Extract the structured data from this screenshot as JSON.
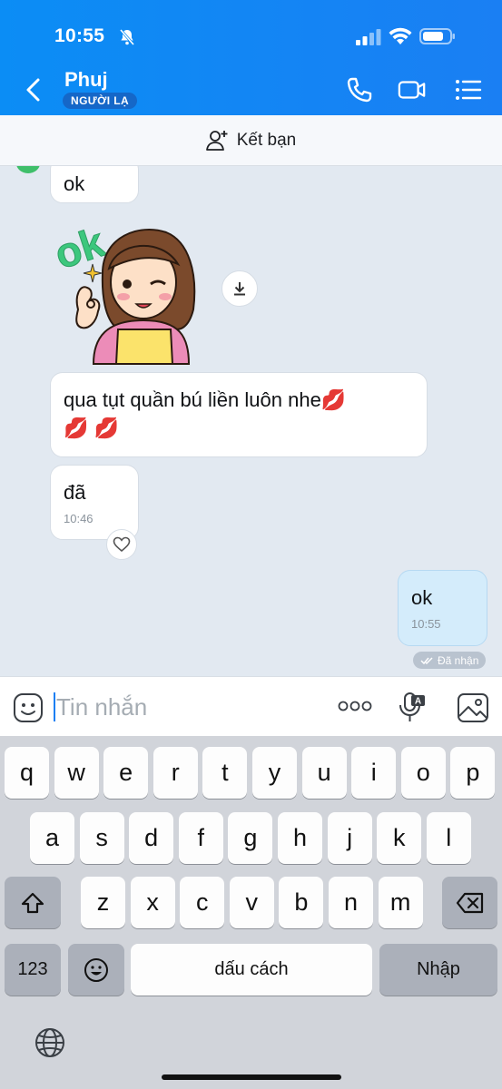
{
  "status_bar": {
    "time": "10:55"
  },
  "header": {
    "contact_name": "Phuj",
    "stranger_label": "NGƯỜI LẠ"
  },
  "friend_bar": {
    "label": "Kết bạn"
  },
  "messages": {
    "m1_text": "ok",
    "m2_text": "qua tụt quần bú liền luôn nhe💋\n💋 💋",
    "m3_text": "đã",
    "m3_time": "10:46",
    "my_text": "ok",
    "my_time": "10:55",
    "received_label": "Đã nhận",
    "sticker_text": "ok"
  },
  "input": {
    "placeholder": "Tin nhắn"
  },
  "keyboard": {
    "row1": [
      "q",
      "w",
      "e",
      "r",
      "t",
      "y",
      "u",
      "i",
      "o",
      "p"
    ],
    "row2": [
      "a",
      "s",
      "d",
      "f",
      "g",
      "h",
      "j",
      "k",
      "l"
    ],
    "row3": [
      "z",
      "x",
      "c",
      "v",
      "b",
      "n",
      "m"
    ],
    "numbers_label": "123",
    "space_label": "dấu cách",
    "return_label": "Nhập"
  },
  "colors": {
    "header_blue": "#0b8df5",
    "my_bubble": "#d4ecfb",
    "chat_bg": "#e2e9f1"
  }
}
